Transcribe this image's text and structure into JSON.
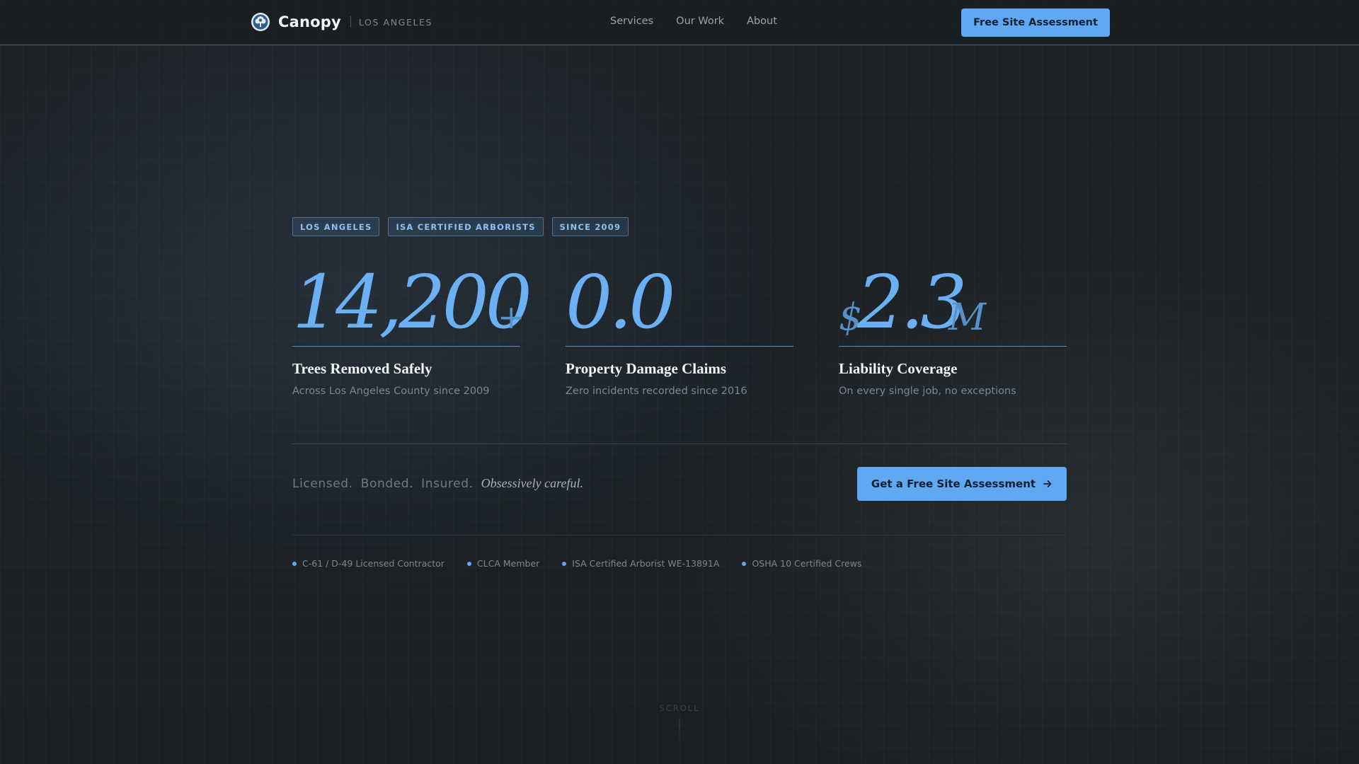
{
  "nav": {
    "brand_name": "Canopy",
    "brand_city": "LOS ANGELES",
    "links": [
      {
        "label": "Services"
      },
      {
        "label": "Our Work"
      },
      {
        "label": "About"
      }
    ],
    "cta_label": "Free Site Assessment"
  },
  "hero": {
    "badges": [
      "LOS ANGELES",
      "ISA CERTIFIED ARBORISTS",
      "SINCE 2009"
    ],
    "stats": [
      {
        "prefix": "",
        "value": "14,200",
        "suffix": "+",
        "title": "Trees Removed Safely",
        "subtitle": "Across Los Angeles County since 2009"
      },
      {
        "prefix": "",
        "value": "0.0",
        "suffix": "",
        "title": "Property Damage Claims",
        "subtitle": "Zero incidents recorded since 2016"
      },
      {
        "prefix": "$",
        "value": "2.3",
        "suffix": "M",
        "title": "Liability Coverage",
        "subtitle": "On every single job, no exceptions"
      }
    ],
    "tagline": {
      "words": [
        "Licensed.",
        "Bonded.",
        "Insured."
      ],
      "emphasis": "Obsessively careful."
    },
    "cta_label": "Get a Free Site Assessment",
    "cta_icon": "arrow-right-icon",
    "credentials": [
      "C-61 / D-49 Licensed Contractor",
      "CLCA Member",
      "ISA Certified Arborist WE-13891A",
      "OSHA 10 Certified Crews"
    ],
    "scroll_label": "SCROLL"
  },
  "colors": {
    "accent": "#5fa8f2",
    "stat_value": "#6cb0f4",
    "background": "#1c2125"
  }
}
